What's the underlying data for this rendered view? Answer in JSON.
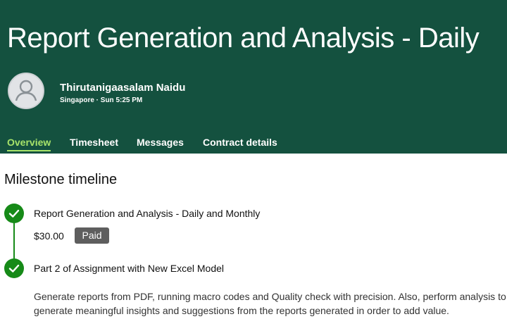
{
  "header": {
    "title": "Report Generation and Analysis - Daily",
    "user": {
      "avatar_icon": "user-icon",
      "name": "Thirutanigaasalam Naidu",
      "meta": "Singapore · Sun 5:25 PM"
    },
    "tabs": [
      {
        "label": "Overview",
        "active": true
      },
      {
        "label": "Timesheet",
        "active": false
      },
      {
        "label": "Messages",
        "active": false
      },
      {
        "label": "Contract details",
        "active": false
      }
    ]
  },
  "colors": {
    "header_bg": "#14513f",
    "active_tab": "#a7e36a",
    "milestone_green": "#168a18",
    "badge_bg": "#5e5e5e"
  },
  "timeline": {
    "title": "Milestone timeline",
    "milestones": [
      {
        "icon": "check-icon",
        "title": "Report Generation and Analysis - Daily and Monthly",
        "amount": "$30.00",
        "status": "Paid"
      },
      {
        "icon": "check-icon",
        "title": "Part 2 of Assignment with New Excel Model",
        "description": "Generate reports from PDF, running macro codes and Quality check with precision. Also, perform analysis to generate meaningful insights and suggestions from the reports generated in order to add value."
      }
    ]
  }
}
